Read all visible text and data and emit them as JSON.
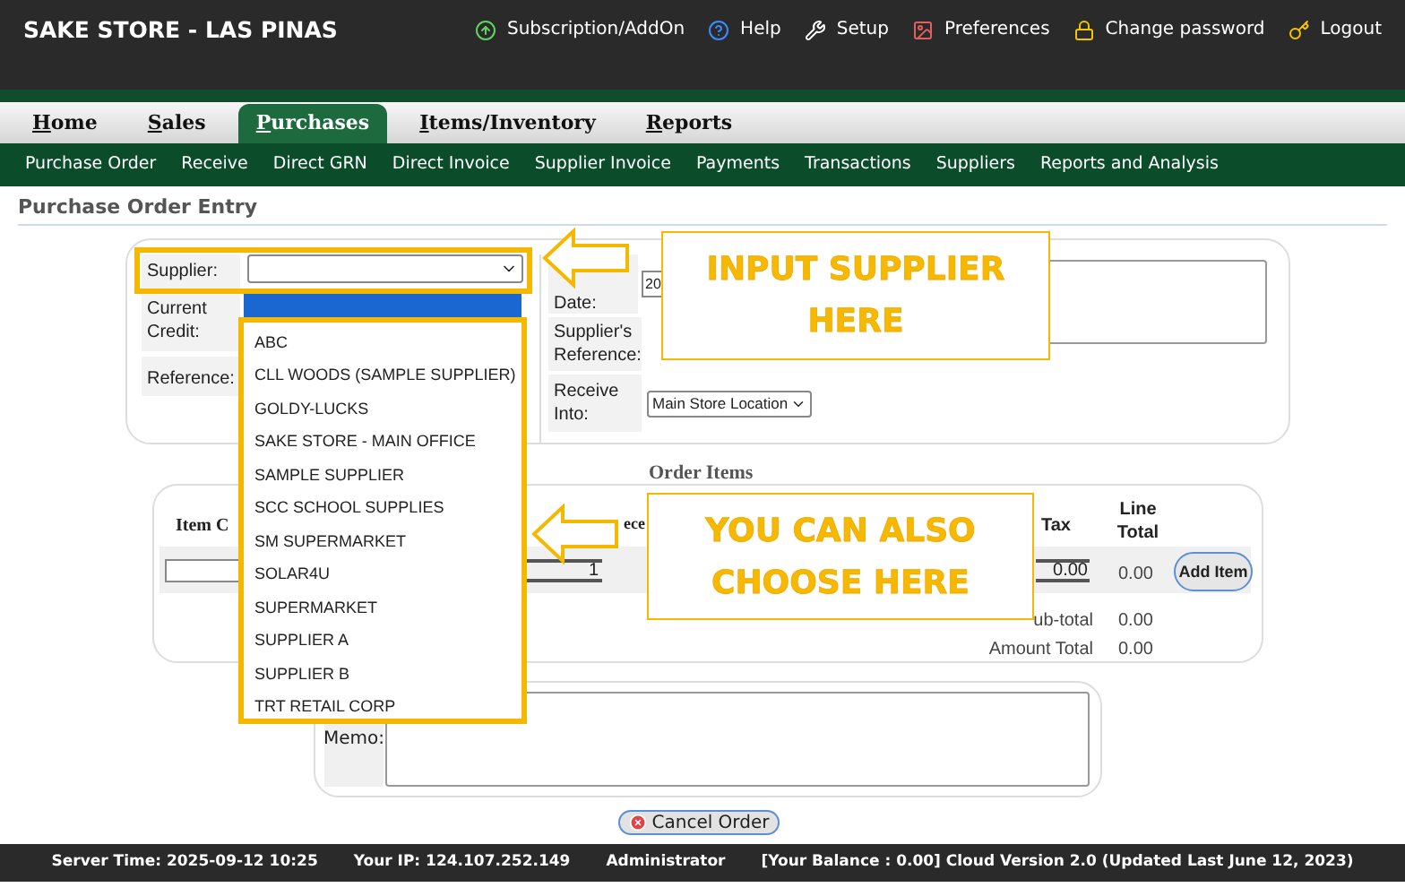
{
  "header": {
    "title": "SAKE STORE - LAS PINAS",
    "links": [
      {
        "label": "Subscription/AddOn",
        "kind": "upgrade"
      },
      {
        "label": "Help",
        "kind": "help"
      },
      {
        "label": "Setup",
        "kind": "tools"
      },
      {
        "label": "Preferences",
        "kind": "preferences"
      },
      {
        "label": "Change password",
        "kind": "lock"
      },
      {
        "label": "Logout",
        "kind": "key"
      }
    ]
  },
  "main_tabs": [
    {
      "label": "Home",
      "selected": false
    },
    {
      "label": "Sales",
      "selected": false
    },
    {
      "label": "Purchases",
      "selected": true
    },
    {
      "label": "Items/Inventory",
      "selected": false
    },
    {
      "label": "Reports",
      "selected": false
    }
  ],
  "sub_nav": [
    "Purchase Order",
    "Receive",
    "Direct GRN",
    "Direct Invoice",
    "Supplier Invoice",
    "Payments",
    "Transactions",
    "Suppliers",
    "Reports and Analysis"
  ],
  "page_title": "Purchase Order Entry",
  "order_form": {
    "supplier_label": "Supplier:",
    "current_credit_label": "Current Credit:",
    "reference_label": "Reference:",
    "date": {
      "label": "Date:",
      "value": "20"
    },
    "supplier_reference_label": "Supplier's Reference:",
    "receive_into": {
      "label": "Receive Into:",
      "value": "Main Store Location"
    }
  },
  "supplier_dropdown": {
    "highlighted_blank_row": true,
    "options": [
      "ABC",
      "CLL WOODS (SAMPLE SUPPLIER)",
      "GOLDY-LUCKS",
      "SAKE STORE - MAIN OFFICE",
      "SAMPLE SUPPLIER",
      "SCC SCHOOL SUPPLIES",
      "SM SUPERMARKET",
      "SOLAR4U",
      "SUPERMARKET",
      "SUPPLIER A",
      "SUPPLIER B",
      "TRT RETAIL CORP"
    ]
  },
  "order_items": {
    "title": "Order Items",
    "columns": {
      "item_code": "Item C",
      "price": "ece",
      "tax": "Tax",
      "line_total": "Line Total"
    },
    "row": {
      "quantity": "1",
      "tax": "0.00",
      "line_total": "0.00"
    },
    "add_button": "Add Item",
    "totals": [
      {
        "label": "ub-total",
        "value": "0.00"
      },
      {
        "label": "Amount Total",
        "value": "0.00"
      }
    ]
  },
  "memo": {
    "label": "Memo:"
  },
  "cancel_button": "Cancel Order",
  "footer": [
    "Server Time: 2025-09-12 10:25",
    "Your IP: 124.107.252.149",
    "Administrator",
    "[Your Balance : 0.00] Cloud Version 2.0 (Updated Last June 12, 2023)"
  ],
  "callouts": [
    {
      "text": "INPUT SUPPLIER HERE"
    },
    {
      "text": "YOU CAN ALSO CHOOSE HERE"
    }
  ]
}
